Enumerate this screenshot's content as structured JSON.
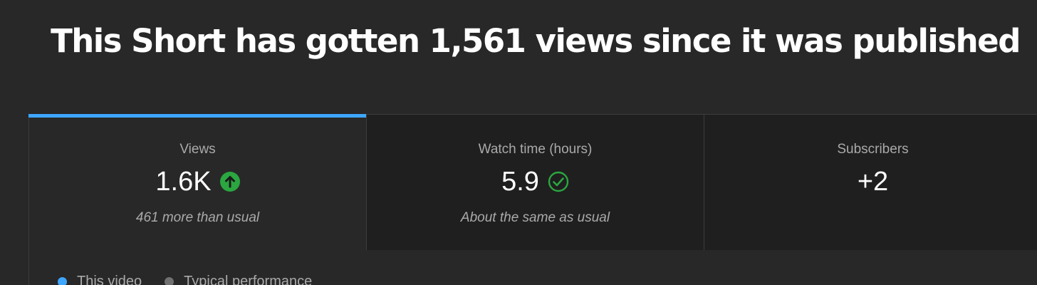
{
  "headline": "This Short has gotten 1,561 views since it was published",
  "colors": {
    "background": "#282828",
    "tab_inactive": "#1f1f1f",
    "accent": "#3ea6ff",
    "positive": "#2ba640",
    "this_video": "#3ea6ff",
    "typical": "#717171"
  },
  "tabs": [
    {
      "label": "Views",
      "value": "1.6K",
      "icon": "arrow-up-circle-icon",
      "note": "461 more than usual",
      "active": true
    },
    {
      "label": "Watch time (hours)",
      "value": "5.9",
      "icon": "check-circle-icon",
      "note": "About the same as usual",
      "active": false
    },
    {
      "label": "Subscribers",
      "value": "+2",
      "icon": "",
      "note": "",
      "active": false
    }
  ],
  "legend": [
    {
      "label": "This video",
      "color": "#3ea6ff"
    },
    {
      "label": "Typical performance",
      "color": "#717171"
    }
  ]
}
